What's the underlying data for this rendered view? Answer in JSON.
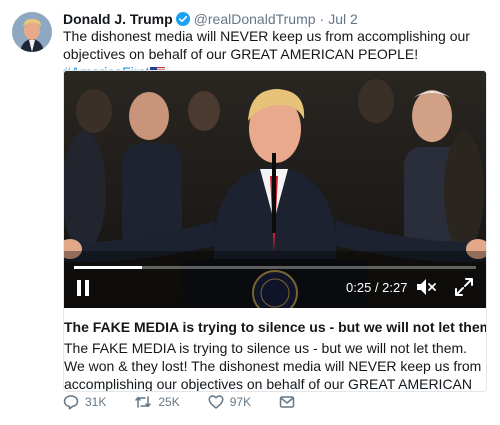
{
  "tweet": {
    "author_name": "Donald J. Trump",
    "handle": "@realDonaldTrump",
    "separator": "·",
    "date": "Jul 2",
    "text": "The dishonest media will NEVER keep us from accomplishing our objectives on behalf of our GREAT AMERICAN PEOPLE!",
    "hashtag": "#AmericaFirst"
  },
  "video": {
    "time_display": "0:25 / 2:27",
    "progress": 0.17
  },
  "card": {
    "title": "The FAKE MEDIA is trying to silence us - but we will not let them!",
    "description": "The FAKE MEDIA is trying to silence us - but we will not let them. We won & they lost! The dishonest media will NEVER keep us from accomplishing our objectives on behalf of our GREAT AMERICAN PEOPLE!"
  },
  "actions": {
    "replies": "31K",
    "retweets": "25K",
    "likes": "97K"
  },
  "colors": {
    "link": "#1b95e0",
    "muted": "#657786",
    "text": "#14171a",
    "border": "#e1e8ed"
  },
  "icons": {
    "verified": "verified-badge-icon",
    "flag": "us-flag-icon",
    "pause": "pause-icon",
    "mute": "volume-muted-icon",
    "fullscreen": "fullscreen-icon",
    "reply": "reply-icon",
    "retweet": "retweet-icon",
    "like": "heart-icon",
    "message": "envelope-icon"
  }
}
